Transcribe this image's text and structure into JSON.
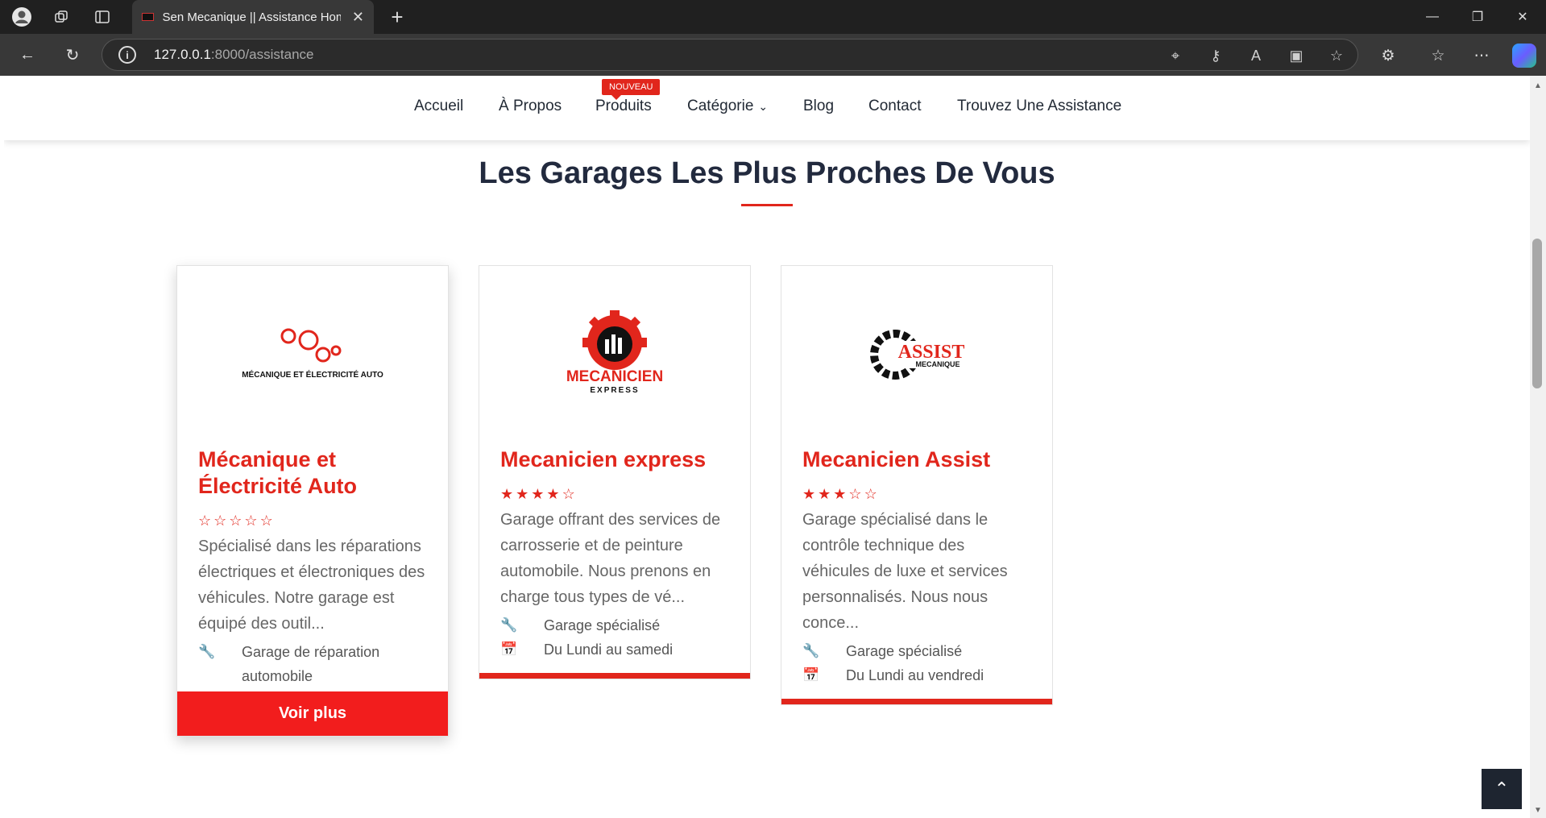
{
  "browser": {
    "tab_title": "Sen Mecanique || Assistance Hom",
    "url_host": "127.0.0.1",
    "url_rest": ":8000/assistance"
  },
  "nav": {
    "items": [
      "Accueil",
      "À Propos",
      "Produits",
      "Catégorie",
      "Blog",
      "Contact",
      "Trouvez Une Assistance"
    ],
    "badge": "NOUVEAU"
  },
  "section": {
    "title": "Les Garages Les Plus Proches De Vous"
  },
  "garages": [
    {
      "name": "Mécanique et Électricité Auto",
      "rating": 0,
      "description": "Spécialisé dans les réparations électriques et électroniques des véhicules. Notre garage est équipé des outil...",
      "type": "Garage de réparation automobile",
      "logo_text": "MÉCANIQUE ET ÉLECTRICITÉ AUTO",
      "button": "Voir plus"
    },
    {
      "name": "Mecanicien express",
      "rating": 4,
      "description": "Garage offrant des services de carrosserie et de peinture automobile. Nous prenons en charge tous types de vé...",
      "type": "Garage spécialisé",
      "hours": "Du Lundi au samedi",
      "logo_text": "MECANICIEN",
      "logo_sub": "EXPRESS"
    },
    {
      "name": "Mecanicien Assist",
      "rating": 3,
      "description": "Garage spécialisé dans le contrôle technique des véhicules de luxe et services personnalisés. Nous nous conce...",
      "type": "Garage spécialisé",
      "hours": "Du Lundi au vendredi",
      "logo_text": "ASSIST",
      "logo_sub": "MECANIQUE"
    }
  ],
  "colors": {
    "accent": "#e1261c",
    "heading": "#222a3e"
  }
}
